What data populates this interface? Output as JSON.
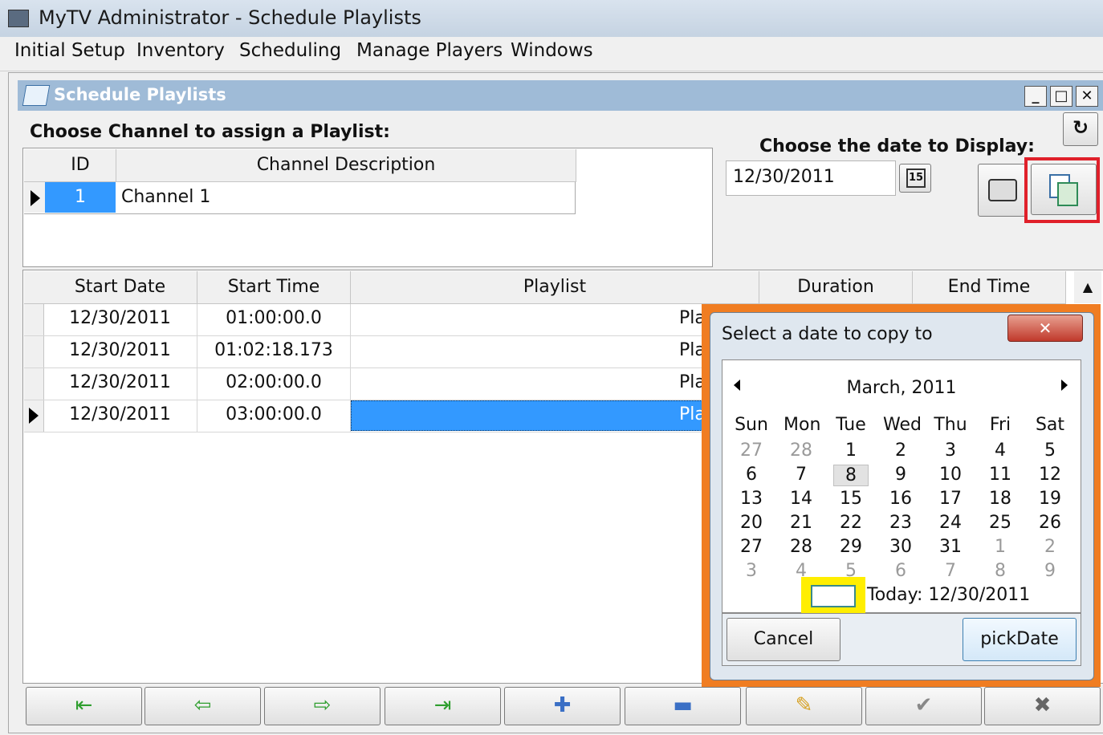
{
  "app": {
    "title": "MyTV Administrator - Schedule Playlists",
    "menu": [
      "Initial Setup",
      "Inventory",
      "Scheduling",
      "Manage Players",
      "Windows"
    ]
  },
  "child_window": {
    "title": "Schedule Playlists",
    "minimize": "_",
    "maximize": "□",
    "close": "✕"
  },
  "channel_section": {
    "label": "Choose Channel to assign a Playlist:",
    "columns": [
      "ID",
      "Channel Description"
    ],
    "rows": [
      {
        "id": "1",
        "description": "Channel 1"
      }
    ]
  },
  "date_section": {
    "label": "Choose the date to Display:",
    "value": "12/30/2011",
    "calendar_button": "15"
  },
  "schedule_grid": {
    "columns": [
      "Start Date",
      "Start Time",
      "Playlist",
      "Duration",
      "End Time"
    ],
    "rows": [
      {
        "start_date": "12/30/2011",
        "start_time": "01:00:00.0",
        "playlist": "Pla"
      },
      {
        "start_date": "12/30/2011",
        "start_time": "01:02:18.173",
        "playlist": "Pla"
      },
      {
        "start_date": "12/30/2011",
        "start_time": "02:00:00.0",
        "playlist": "Pla"
      },
      {
        "start_date": "12/30/2011",
        "start_time": "03:00:00.0",
        "playlist": "Pla"
      }
    ]
  },
  "dialog": {
    "title": "Select a date to copy to",
    "close": "✕",
    "month": "March, 2011",
    "weekdays": [
      "Sun",
      "Mon",
      "Tue",
      "Wed",
      "Thu",
      "Fri",
      "Sat"
    ],
    "weeks": [
      [
        "27",
        "28",
        "1",
        "2",
        "3",
        "4",
        "5"
      ],
      [
        "6",
        "7",
        "8",
        "9",
        "10",
        "11",
        "12"
      ],
      [
        "13",
        "14",
        "15",
        "16",
        "17",
        "18",
        "19"
      ],
      [
        "20",
        "21",
        "22",
        "23",
        "24",
        "25",
        "26"
      ],
      [
        "27",
        "28",
        "29",
        "30",
        "31",
        "1",
        "2"
      ],
      [
        "3",
        "4",
        "5",
        "6",
        "7",
        "8",
        "9"
      ]
    ],
    "today": "Today: 12/30/2011",
    "cancel": "Cancel",
    "pick": "pickDate"
  },
  "colors": {
    "selection": "#3399ff",
    "highlight_red": "#e0202a",
    "highlight_orange": "#f07d22",
    "highlight_yellow": "#ffee00"
  }
}
